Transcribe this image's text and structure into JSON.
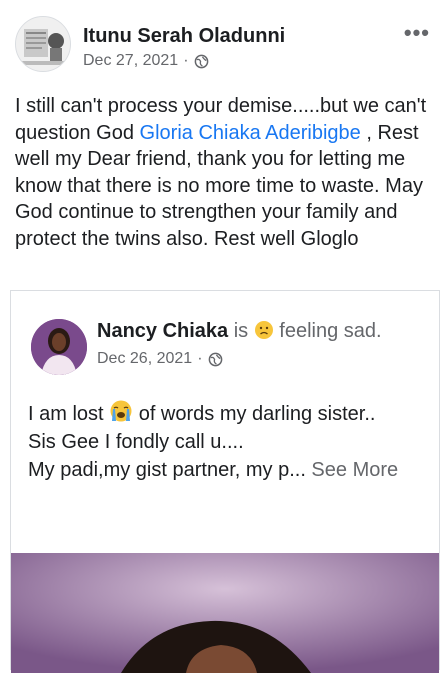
{
  "post": {
    "author": "Itunu Serah Oladunni",
    "date": "Dec 27, 2021",
    "separator": "·",
    "privacy_icon": "globe-icon",
    "more_label": "•••",
    "text_part1": "I still can't process your demise.....but we can't question God ",
    "tag": "Gloria Chiaka Aderibigbe",
    "text_part2": " , Rest well my Dear friend, thank you for letting me know that there is no more time to waste. May God continue to strengthen your family and protect the twins also.  Rest well Gloglo"
  },
  "shared": {
    "author": "Nancy Chiaka",
    "feeling_prefix": " is ",
    "feeling_emoji_icon": "sad-face-icon",
    "feeling_text": " feeling sad.",
    "date": "Dec 26, 2021",
    "separator": "·",
    "privacy_icon": "globe-icon",
    "line1_a": "I am lost ",
    "line1_emoji_icon": "crying-face-icon",
    "line1_b": " of words my darling sister..",
    "line2": "Sis Gee I fondly call u....",
    "line3": "My padi,my gist partner, my p...",
    "see_more": " See More"
  }
}
